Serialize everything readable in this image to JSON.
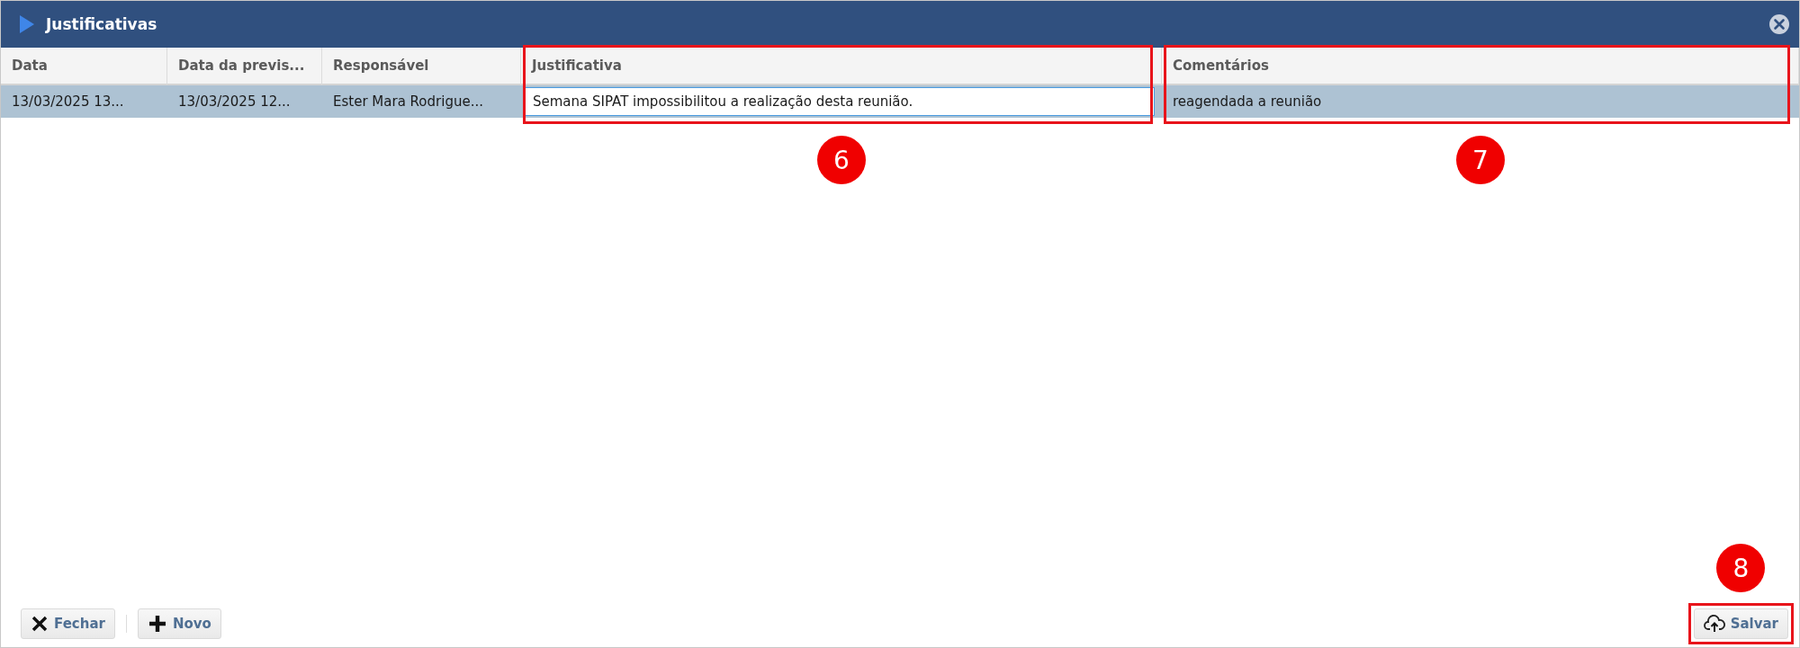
{
  "window": {
    "title": "Justificativas"
  },
  "table": {
    "columns": [
      {
        "label": "Data"
      },
      {
        "label": "Data da previs..."
      },
      {
        "label": "Responsável"
      },
      {
        "label": "Justificativa",
        "callout": "6"
      },
      {
        "label": "Comentários",
        "callout": "7"
      }
    ],
    "rows": [
      {
        "selected": true,
        "cells": [
          {
            "text": "13/03/2025 13...",
            "editing": false
          },
          {
            "text": "13/03/2025 12...",
            "editing": false
          },
          {
            "text": "Ester Mara Rodrigue...",
            "editing": false
          },
          {
            "text": "Semana SIPAT impossibilitou a realização desta reunião.",
            "editing": true
          },
          {
            "text": "reagendada a reunião",
            "editing": false
          }
        ]
      }
    ]
  },
  "footer": {
    "left_buttons": [
      {
        "label": "Fechar",
        "kind": "close"
      },
      {
        "label": "Novo",
        "kind": "new"
      }
    ],
    "right_buttons": [
      {
        "label": "Salvar",
        "kind": "save",
        "callout": "8"
      }
    ]
  }
}
